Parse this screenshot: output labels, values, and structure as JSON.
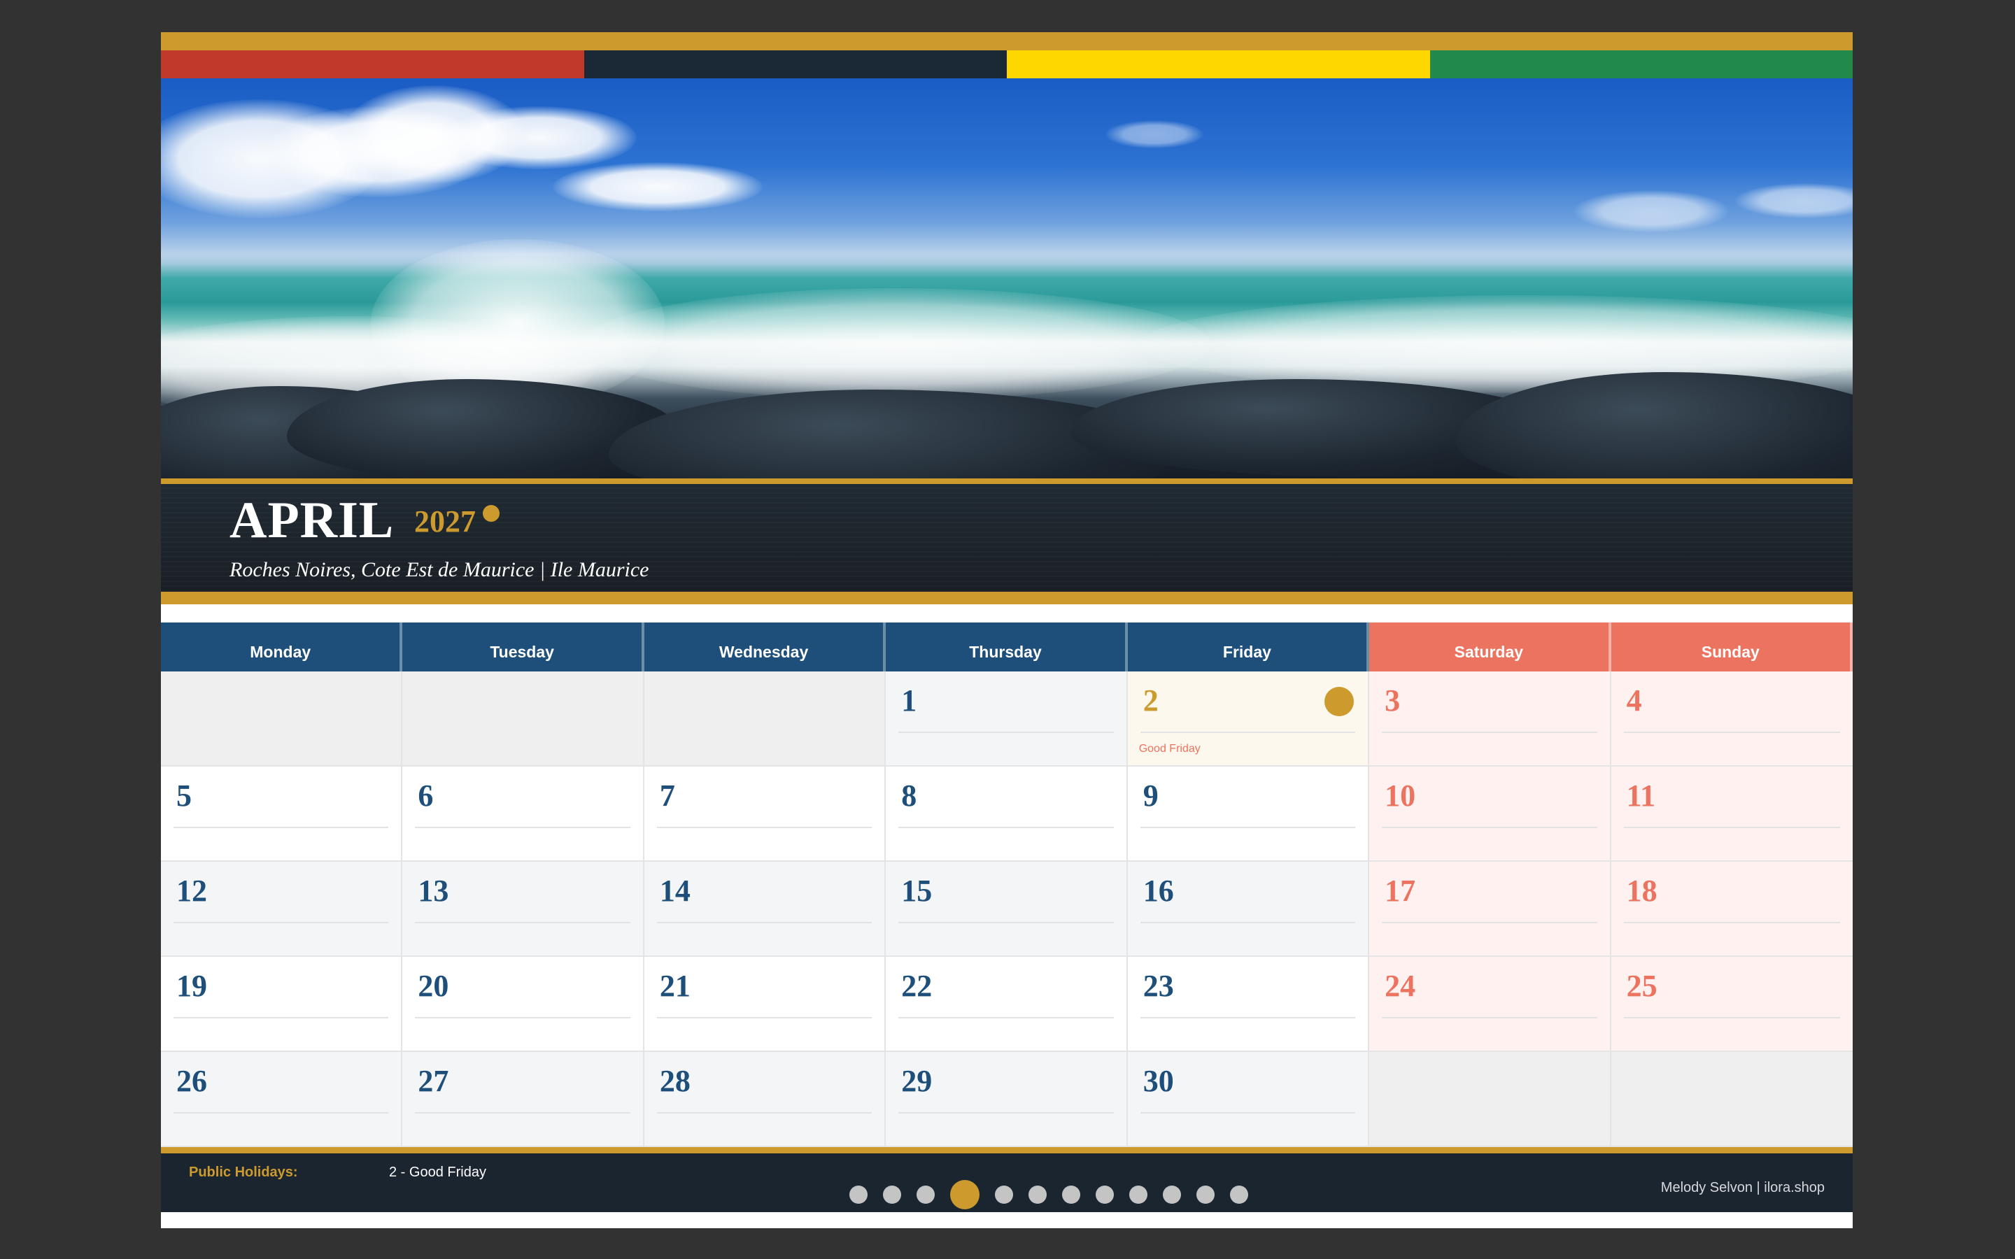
{
  "calendar": {
    "month": "APRIL",
    "year": "2027",
    "location": "Roches Noires, Cote Est de Maurice  |  Ile Maurice",
    "weekdays": [
      "Monday",
      "Tuesday",
      "Wednesday",
      "Thursday",
      "Friday",
      "Saturday",
      "Sunday"
    ],
    "weeks": [
      [
        "",
        "",
        "",
        "1",
        "2",
        "3",
        "4"
      ],
      [
        "5",
        "6",
        "7",
        "8",
        "9",
        "10",
        "11"
      ],
      [
        "12",
        "13",
        "14",
        "15",
        "16",
        "17",
        "18"
      ],
      [
        "19",
        "20",
        "21",
        "22",
        "23",
        "24",
        "25"
      ],
      [
        "26",
        "27",
        "28",
        "29",
        "30",
        "",
        ""
      ]
    ],
    "holiday_note": "Good Friday"
  },
  "footer": {
    "public_holidays_label": "Public Holidays:",
    "public_holidays_list": "2 - Good Friday",
    "credit": "Melody Selvon  |  ilora.shop"
  },
  "pager": {
    "total": 12,
    "active_index": 3
  },
  "colors": {
    "gold": "#cd9a2e",
    "navy": "#1e4f7a",
    "coral": "#ec735f",
    "flag_red": "#c0392b",
    "flag_blue": "#1b2836",
    "flag_yellow": "#ffd700",
    "flag_green": "#218a4a"
  }
}
